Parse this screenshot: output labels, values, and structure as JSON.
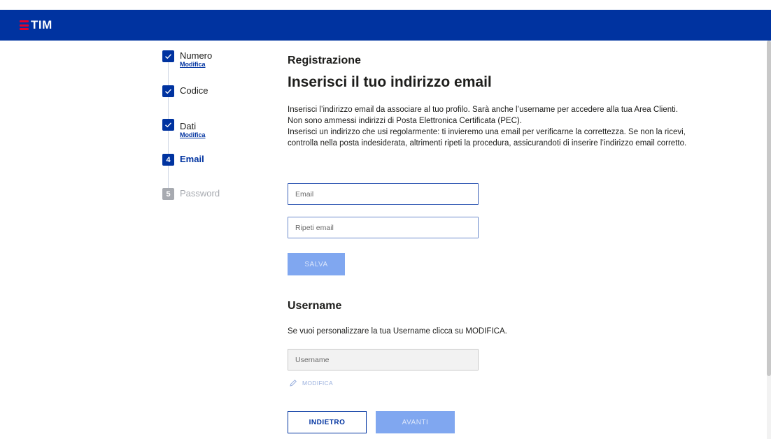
{
  "header": {
    "brand": "TIM"
  },
  "stepper": {
    "steps": [
      {
        "label": "Numero",
        "status": "done",
        "edit_label": "Modifica"
      },
      {
        "label": "Codice",
        "status": "done"
      },
      {
        "label": "Dati",
        "status": "done",
        "edit_label": "Modifica"
      },
      {
        "label": "Email",
        "status": "active",
        "number": "4"
      },
      {
        "label": "Password",
        "status": "pending",
        "number": "5"
      }
    ]
  },
  "main": {
    "section_label": "Registrazione",
    "title": "Inserisci il tuo indirizzo email",
    "description": [
      "Inserisci l’indirizzo email da associare al tuo profilo. Sarà anche l’username per accedere alla tua Area Clienti.",
      "Non sono ammessi indirizzi di Posta Elettronica Certificata (PEC).",
      "Inserisci un indirizzo che usi regolarmente: ti invieremo una email per verificarne la correttezza. Se non la ricevi, controlla nella posta indesiderata, altrimenti ripeti la procedura, assicurandoti di inserire l’indirizzo email corretto."
    ],
    "email_placeholder": "Email",
    "repeat_email_placeholder": "Ripeti email",
    "save_label": "SALVA"
  },
  "username": {
    "title": "Username",
    "description": "Se vuoi personalizzare la tua Username clicca su MODIFICA.",
    "placeholder": "Username",
    "edit_label": "MODIFICA"
  },
  "nav": {
    "back_label": "INDIETRO",
    "next_label": "AVANTI"
  },
  "colors": {
    "brand_blue": "#0033a0",
    "brand_red": "#e4002b",
    "disabled_blue": "#80a7f0",
    "inactive_grey": "#a7aab0"
  }
}
